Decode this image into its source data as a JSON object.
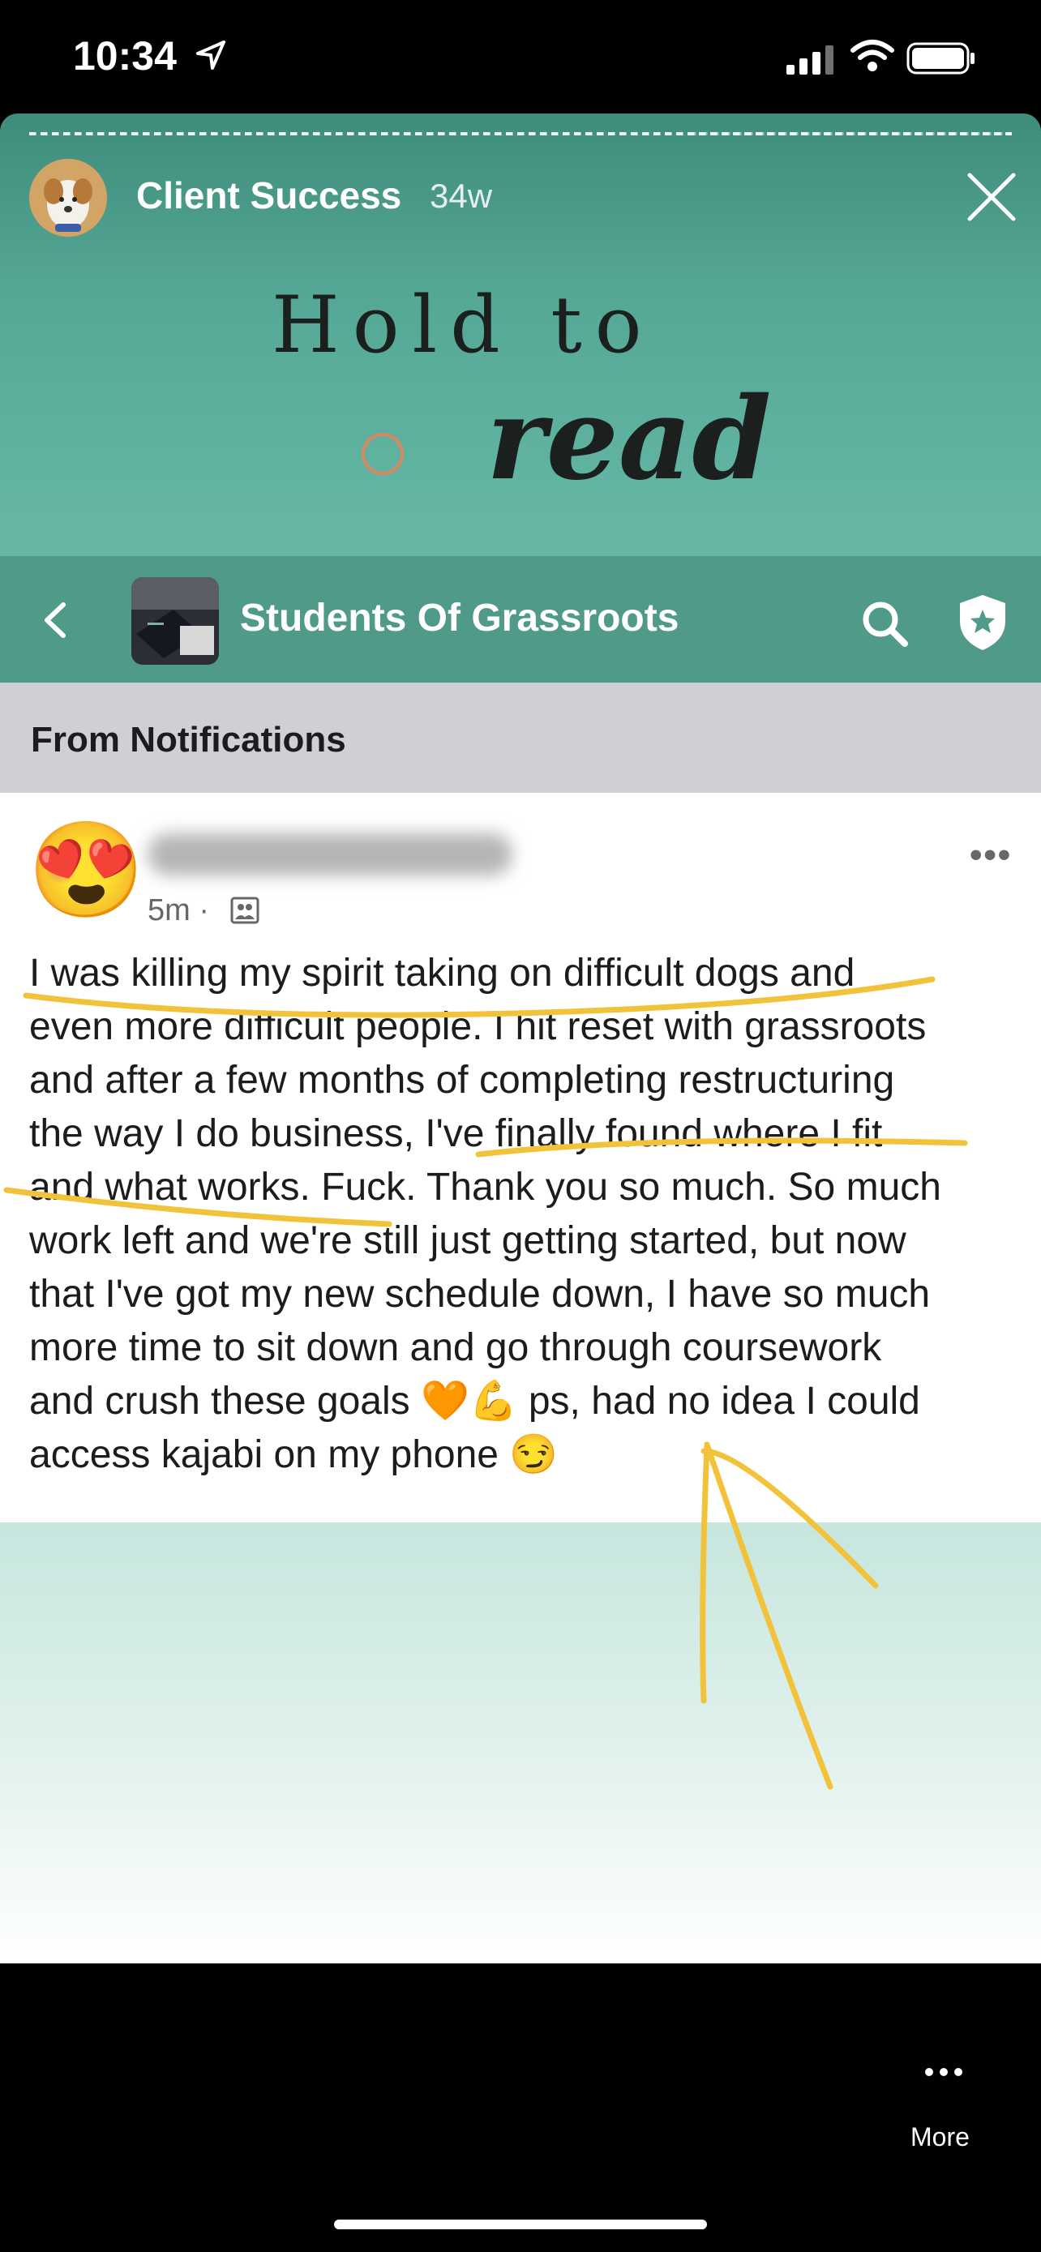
{
  "status_bar": {
    "time": "10:34"
  },
  "story": {
    "title": "Client Success",
    "age": "34w",
    "sticker_line1": "Hold to",
    "sticker_line2": "read"
  },
  "group": {
    "name": "Students Of Grassroots",
    "section": "From Notifications"
  },
  "post": {
    "author_emoji": "😍",
    "time": "5m ·",
    "more": "•••",
    "body": "I was killing my spirit taking on difficult dogs and\neven more difficult people. I hit reset with grassroots\nand after a few months of completing restructuring\nthe way I do business, I've finally found where I fit\nand what works. Fuck. Thank you so much. So much\nwork left and we're still just getting started, but now\nthat I've got my new schedule down, I have so much\nmore time to sit down and go through coursework\nand crush these goals 🧡💪 ps, had no idea I could\naccess kajabi on my phone 😏"
  },
  "footer": {
    "more_label": "More"
  },
  "colors": {
    "accent_teal": "#4f9a88",
    "highlight": "#f2c23a"
  }
}
